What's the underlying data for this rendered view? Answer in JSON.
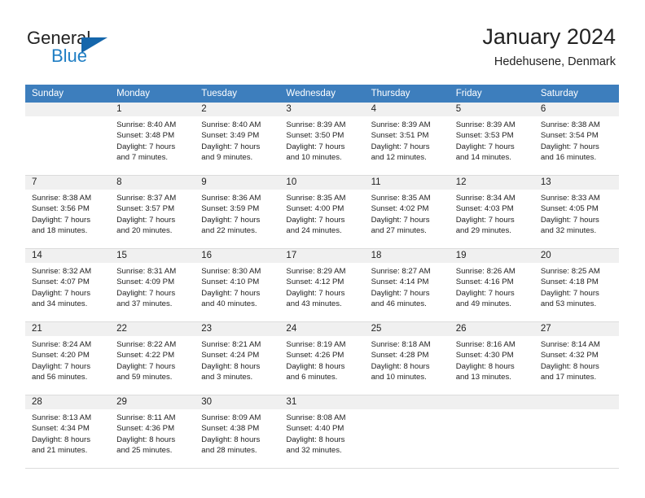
{
  "brand": {
    "name_line1": "General",
    "name_line2": "Blue",
    "accent_color": "#1566ab",
    "secondary_color": "#1f7ec4"
  },
  "header": {
    "title": "January 2024",
    "subtitle": "Hedehusene, Denmark"
  },
  "calendar": {
    "header_bg": "#3d7ebd",
    "daynum_bg": "#f0f0f0",
    "weekday_headers": [
      "Sunday",
      "Monday",
      "Tuesday",
      "Wednesday",
      "Thursday",
      "Friday",
      "Saturday"
    ],
    "weeks": [
      [
        {
          "day": "",
          "sunrise": "",
          "sunset": "",
          "daylight_1": "",
          "daylight_2": ""
        },
        {
          "day": "1",
          "sunrise": "Sunrise: 8:40 AM",
          "sunset": "Sunset: 3:48 PM",
          "daylight_1": "Daylight: 7 hours",
          "daylight_2": "and 7 minutes."
        },
        {
          "day": "2",
          "sunrise": "Sunrise: 8:40 AM",
          "sunset": "Sunset: 3:49 PM",
          "daylight_1": "Daylight: 7 hours",
          "daylight_2": "and 9 minutes."
        },
        {
          "day": "3",
          "sunrise": "Sunrise: 8:39 AM",
          "sunset": "Sunset: 3:50 PM",
          "daylight_1": "Daylight: 7 hours",
          "daylight_2": "and 10 minutes."
        },
        {
          "day": "4",
          "sunrise": "Sunrise: 8:39 AM",
          "sunset": "Sunset: 3:51 PM",
          "daylight_1": "Daylight: 7 hours",
          "daylight_2": "and 12 minutes."
        },
        {
          "day": "5",
          "sunrise": "Sunrise: 8:39 AM",
          "sunset": "Sunset: 3:53 PM",
          "daylight_1": "Daylight: 7 hours",
          "daylight_2": "and 14 minutes."
        },
        {
          "day": "6",
          "sunrise": "Sunrise: 8:38 AM",
          "sunset": "Sunset: 3:54 PM",
          "daylight_1": "Daylight: 7 hours",
          "daylight_2": "and 16 minutes."
        }
      ],
      [
        {
          "day": "7",
          "sunrise": "Sunrise: 8:38 AM",
          "sunset": "Sunset: 3:56 PM",
          "daylight_1": "Daylight: 7 hours",
          "daylight_2": "and 18 minutes."
        },
        {
          "day": "8",
          "sunrise": "Sunrise: 8:37 AM",
          "sunset": "Sunset: 3:57 PM",
          "daylight_1": "Daylight: 7 hours",
          "daylight_2": "and 20 minutes."
        },
        {
          "day": "9",
          "sunrise": "Sunrise: 8:36 AM",
          "sunset": "Sunset: 3:59 PM",
          "daylight_1": "Daylight: 7 hours",
          "daylight_2": "and 22 minutes."
        },
        {
          "day": "10",
          "sunrise": "Sunrise: 8:35 AM",
          "sunset": "Sunset: 4:00 PM",
          "daylight_1": "Daylight: 7 hours",
          "daylight_2": "and 24 minutes."
        },
        {
          "day": "11",
          "sunrise": "Sunrise: 8:35 AM",
          "sunset": "Sunset: 4:02 PM",
          "daylight_1": "Daylight: 7 hours",
          "daylight_2": "and 27 minutes."
        },
        {
          "day": "12",
          "sunrise": "Sunrise: 8:34 AM",
          "sunset": "Sunset: 4:03 PM",
          "daylight_1": "Daylight: 7 hours",
          "daylight_2": "and 29 minutes."
        },
        {
          "day": "13",
          "sunrise": "Sunrise: 8:33 AM",
          "sunset": "Sunset: 4:05 PM",
          "daylight_1": "Daylight: 7 hours",
          "daylight_2": "and 32 minutes."
        }
      ],
      [
        {
          "day": "14",
          "sunrise": "Sunrise: 8:32 AM",
          "sunset": "Sunset: 4:07 PM",
          "daylight_1": "Daylight: 7 hours",
          "daylight_2": "and 34 minutes."
        },
        {
          "day": "15",
          "sunrise": "Sunrise: 8:31 AM",
          "sunset": "Sunset: 4:09 PM",
          "daylight_1": "Daylight: 7 hours",
          "daylight_2": "and 37 minutes."
        },
        {
          "day": "16",
          "sunrise": "Sunrise: 8:30 AM",
          "sunset": "Sunset: 4:10 PM",
          "daylight_1": "Daylight: 7 hours",
          "daylight_2": "and 40 minutes."
        },
        {
          "day": "17",
          "sunrise": "Sunrise: 8:29 AM",
          "sunset": "Sunset: 4:12 PM",
          "daylight_1": "Daylight: 7 hours",
          "daylight_2": "and 43 minutes."
        },
        {
          "day": "18",
          "sunrise": "Sunrise: 8:27 AM",
          "sunset": "Sunset: 4:14 PM",
          "daylight_1": "Daylight: 7 hours",
          "daylight_2": "and 46 minutes."
        },
        {
          "day": "19",
          "sunrise": "Sunrise: 8:26 AM",
          "sunset": "Sunset: 4:16 PM",
          "daylight_1": "Daylight: 7 hours",
          "daylight_2": "and 49 minutes."
        },
        {
          "day": "20",
          "sunrise": "Sunrise: 8:25 AM",
          "sunset": "Sunset: 4:18 PM",
          "daylight_1": "Daylight: 7 hours",
          "daylight_2": "and 53 minutes."
        }
      ],
      [
        {
          "day": "21",
          "sunrise": "Sunrise: 8:24 AM",
          "sunset": "Sunset: 4:20 PM",
          "daylight_1": "Daylight: 7 hours",
          "daylight_2": "and 56 minutes."
        },
        {
          "day": "22",
          "sunrise": "Sunrise: 8:22 AM",
          "sunset": "Sunset: 4:22 PM",
          "daylight_1": "Daylight: 7 hours",
          "daylight_2": "and 59 minutes."
        },
        {
          "day": "23",
          "sunrise": "Sunrise: 8:21 AM",
          "sunset": "Sunset: 4:24 PM",
          "daylight_1": "Daylight: 8 hours",
          "daylight_2": "and 3 minutes."
        },
        {
          "day": "24",
          "sunrise": "Sunrise: 8:19 AM",
          "sunset": "Sunset: 4:26 PM",
          "daylight_1": "Daylight: 8 hours",
          "daylight_2": "and 6 minutes."
        },
        {
          "day": "25",
          "sunrise": "Sunrise: 8:18 AM",
          "sunset": "Sunset: 4:28 PM",
          "daylight_1": "Daylight: 8 hours",
          "daylight_2": "and 10 minutes."
        },
        {
          "day": "26",
          "sunrise": "Sunrise: 8:16 AM",
          "sunset": "Sunset: 4:30 PM",
          "daylight_1": "Daylight: 8 hours",
          "daylight_2": "and 13 minutes."
        },
        {
          "day": "27",
          "sunrise": "Sunrise: 8:14 AM",
          "sunset": "Sunset: 4:32 PM",
          "daylight_1": "Daylight: 8 hours",
          "daylight_2": "and 17 minutes."
        }
      ],
      [
        {
          "day": "28",
          "sunrise": "Sunrise: 8:13 AM",
          "sunset": "Sunset: 4:34 PM",
          "daylight_1": "Daylight: 8 hours",
          "daylight_2": "and 21 minutes."
        },
        {
          "day": "29",
          "sunrise": "Sunrise: 8:11 AM",
          "sunset": "Sunset: 4:36 PM",
          "daylight_1": "Daylight: 8 hours",
          "daylight_2": "and 25 minutes."
        },
        {
          "day": "30",
          "sunrise": "Sunrise: 8:09 AM",
          "sunset": "Sunset: 4:38 PM",
          "daylight_1": "Daylight: 8 hours",
          "daylight_2": "and 28 minutes."
        },
        {
          "day": "31",
          "sunrise": "Sunrise: 8:08 AM",
          "sunset": "Sunset: 4:40 PM",
          "daylight_1": "Daylight: 8 hours",
          "daylight_2": "and 32 minutes."
        },
        {
          "day": "",
          "sunrise": "",
          "sunset": "",
          "daylight_1": "",
          "daylight_2": ""
        },
        {
          "day": "",
          "sunrise": "",
          "sunset": "",
          "daylight_1": "",
          "daylight_2": ""
        },
        {
          "day": "",
          "sunrise": "",
          "sunset": "",
          "daylight_1": "",
          "daylight_2": ""
        }
      ]
    ]
  }
}
